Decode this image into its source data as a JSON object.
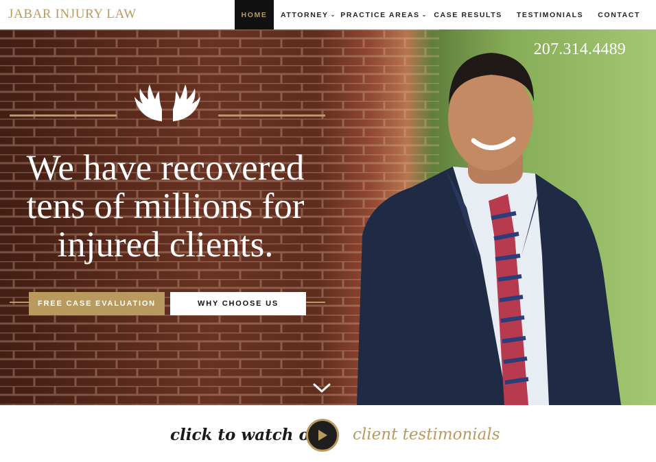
{
  "brand": {
    "logo": "JABAR INJURY LAW"
  },
  "nav": {
    "items": [
      {
        "label": "HOME",
        "active": true
      },
      {
        "label": "ATTORNEY",
        "dropdown": true
      },
      {
        "label": "PRACTICE AREAS",
        "dropdown": true
      },
      {
        "label": "CASE RESULTS"
      },
      {
        "label": "TESTIMONIALS"
      },
      {
        "label": "CONTACT"
      }
    ],
    "chevron_icon": "chevron-down-icon"
  },
  "hero": {
    "phone": "207.314.4489",
    "headline_lines": [
      "We have recovered",
      "tens of millions for",
      "injured clients."
    ],
    "primary_button": "FREE CASE EVALUATION",
    "secondary_button": "WHY CHOOSE US",
    "emblem_icon": "antlers-icon",
    "scroll_icon": "chevron-down-icon"
  },
  "strip": {
    "lead_text": "click to watch our",
    "play_icon": "play-icon",
    "tail_text": "client testimonials"
  },
  "colors": {
    "gold": "#b89a5e",
    "dark": "#111111",
    "white": "#ffffff"
  }
}
